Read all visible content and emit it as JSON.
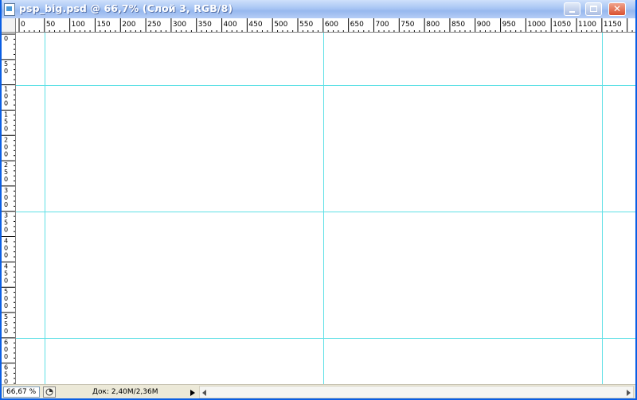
{
  "window": {
    "title": "psp_big.psd @ 66,7% (Слой 3, RGB/8)"
  },
  "icons": {
    "app": "document-icon",
    "minimize": "minimize-icon",
    "maximize": "maximize-icon",
    "close": "close-icon",
    "preview": "status-preview-icon"
  },
  "rulers": {
    "horizontal_labels": [
      "0",
      "50",
      "100",
      "150",
      "200",
      "250",
      "300",
      "350",
      "400",
      "450",
      "500",
      "550",
      "600",
      "650",
      "700",
      "750",
      "800",
      "850",
      "900",
      "950",
      "1000",
      "1050",
      "1100",
      "1150"
    ],
    "vertical_labels": [
      "0",
      "50",
      "100",
      "150",
      "200",
      "250",
      "300",
      "350",
      "400",
      "450",
      "500",
      "550",
      "600",
      "650"
    ]
  },
  "guides": {
    "color": "#5fe0e6",
    "vertical_positions": [
      50,
      600,
      1150
    ],
    "horizontal_positions": [
      100,
      350,
      600
    ]
  },
  "status": {
    "zoom": "66,67 %",
    "doc_info": "Док: 2,40M/2,36M"
  }
}
